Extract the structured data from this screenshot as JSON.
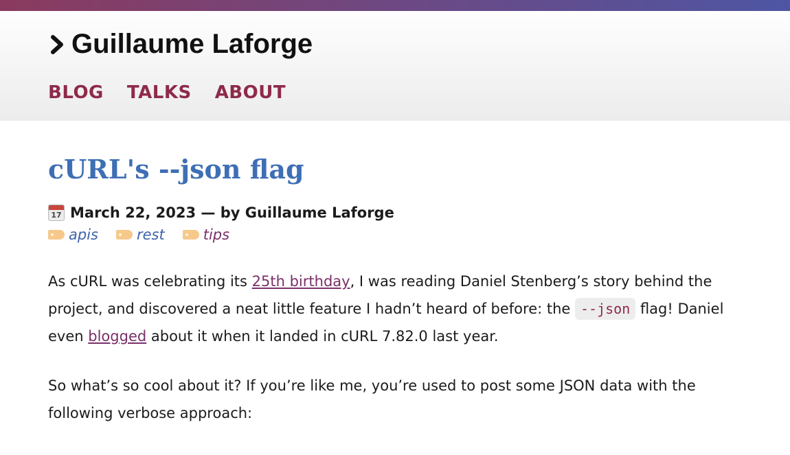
{
  "header": {
    "site_title": "Guillaume Laforge",
    "nav": [
      {
        "label": "BLOG"
      },
      {
        "label": "TALKS"
      },
      {
        "label": "ABOUT"
      }
    ]
  },
  "post": {
    "title": "cURL's --json flag",
    "meta": {
      "calendar_icon_day": "17",
      "text": "March 22, 2023 — by Guillaume Laforge"
    },
    "tags": [
      {
        "label": "apis",
        "icon": "tag-icon"
      },
      {
        "label": "rest",
        "icon": "tag-icon"
      },
      {
        "label": "tips",
        "icon": "tag-icon"
      }
    ],
    "paragraph1": {
      "t1": "As cURL was celebrating its ",
      "link1": "25th birthday",
      "t2": ", I was reading Daniel Stenberg’s story behind the project, and discovered a neat little feature I hadn’t heard of before: the ",
      "code": "--json",
      "t3": " flag! Daniel even ",
      "link2": "blogged",
      "t4": " about it when it landed in cURL 7.82.0 last year."
    },
    "paragraph2": "So what’s so cool about it? If you’re like me, you’re used to post some JSON data with the following verbose approach:"
  },
  "colors": {
    "accent_nav": "#8e2a4a",
    "title_blue": "#3e6fb4",
    "link_purple": "#7a2f68",
    "topbar_gradient": [
      "#8b3a5e",
      "#4e56a4"
    ]
  }
}
